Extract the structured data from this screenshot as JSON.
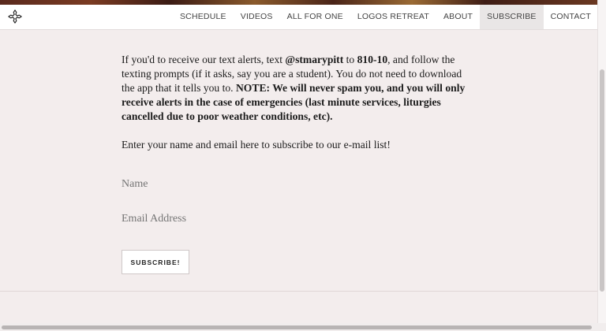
{
  "nav": {
    "items": [
      {
        "label": "SCHEDULE"
      },
      {
        "label": "VIDEOS"
      },
      {
        "label": "ALL FOR ONE"
      },
      {
        "label": "LOGOS RETREAT"
      },
      {
        "label": "ABOUT"
      },
      {
        "label": "SUBSCRIBE"
      },
      {
        "label": "CONTACT"
      }
    ],
    "active": "SUBSCRIBE"
  },
  "intro": {
    "t1": "If you'd to receive our text alerts, text ",
    "handle": "@stmarypitt",
    "t2": " to ",
    "number": "810-10",
    "t3": ", and follow the texting prompts (if it asks, say you are a student). You do not need to download the app that it tells you to. ",
    "note": "NOTE: We will never spam you, and you will only receive alerts in the case of emergencies (last minute services, liturgies cancelled due to poor weather conditions, etc)."
  },
  "subscribe_text": "Enter your name and email here to subscribe to our e-mail list!",
  "form": {
    "name_placeholder": "Name",
    "email_placeholder": "Email Address",
    "submit_label": "SUBSCRIBE!"
  },
  "colors": {
    "background": "#f3eded",
    "navbar": "#ffffff",
    "active_tab": "#e9e6e6"
  }
}
